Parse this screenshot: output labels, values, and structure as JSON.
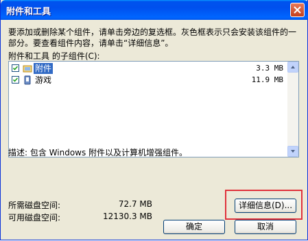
{
  "window": {
    "title": "附件和工具"
  },
  "description": "要添加或删除某个组件，请单击旁边的复选框。灰色框表示只会安装该组件的一部分。要查看组件内容，请单击“详细信息”。",
  "components_label": "附件和工具 的子组件(C):",
  "components": [
    {
      "name": "附件",
      "size": "3.3 MB",
      "checked": true,
      "selected": true,
      "icon": "accessories-icon"
    },
    {
      "name": "游戏",
      "size": "11.9 MB",
      "checked": true,
      "selected": false,
      "icon": "games-icon"
    }
  ],
  "detail_text": "描述:  包含 Windows 附件以及计算机增强组件。",
  "disk": {
    "required_label": "所需磁盘空间:",
    "required_value": "72.7 MB",
    "available_label": "可用磁盘空间:",
    "available_value": "12130.3 MB"
  },
  "buttons": {
    "details": "详细信息(D)...",
    "ok": "确定",
    "cancel": "取消"
  },
  "colors": {
    "highlight": "#e0303a",
    "selection": "#316ac5"
  }
}
